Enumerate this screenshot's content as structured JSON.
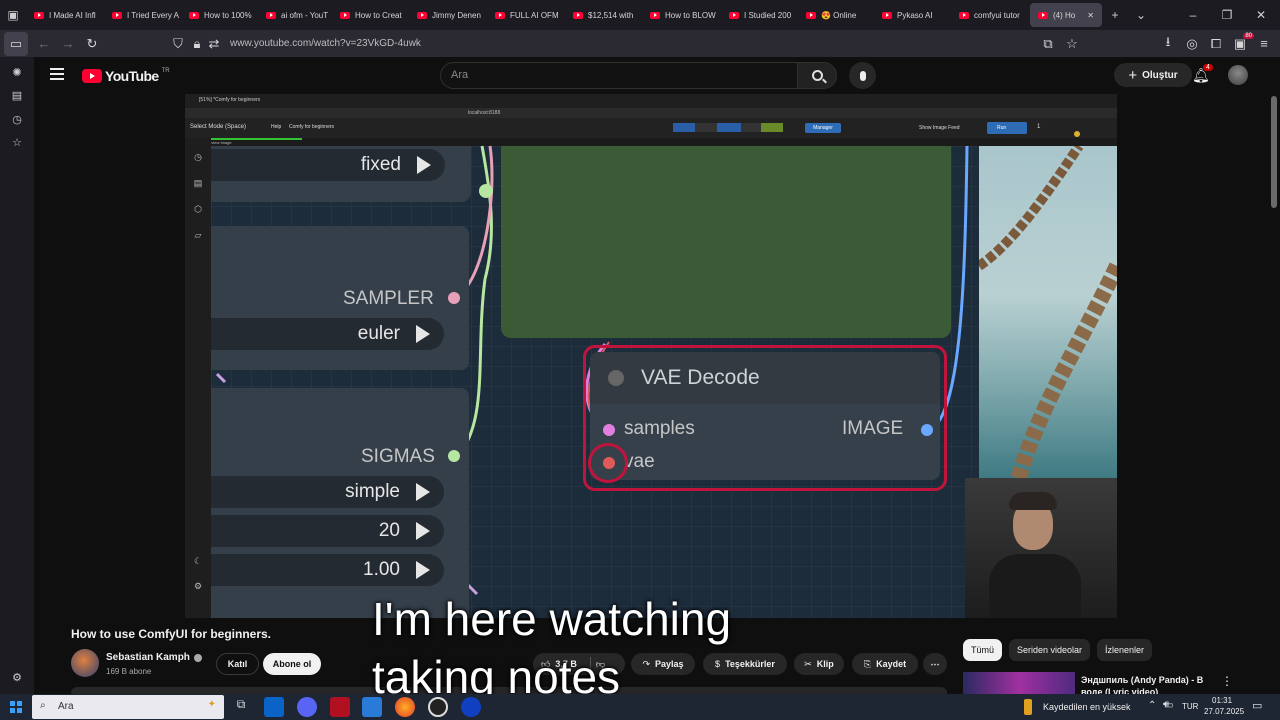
{
  "browser": {
    "tabs": [
      {
        "label": "I Made AI Infl",
        "active": false
      },
      {
        "label": "I Tried Every A",
        "active": false
      },
      {
        "label": "How to 100%",
        "active": false
      },
      {
        "label": "ai ofm - YouT",
        "active": false
      },
      {
        "label": "How to Creat",
        "active": false
      },
      {
        "label": "Jimmy Denen",
        "active": false
      },
      {
        "label": "FULL AI OFM",
        "active": false
      },
      {
        "label": "$12,514 with",
        "active": false
      },
      {
        "label": "How to BLOW",
        "active": false
      },
      {
        "label": "I Studied 200",
        "active": false
      },
      {
        "label": "😍 Online",
        "active": false
      },
      {
        "label": "Pykaso AI",
        "active": false
      },
      {
        "label": "comfyui tutor",
        "active": false
      },
      {
        "label": "(4) Ho",
        "active": true
      }
    ],
    "url": "www.youtube.com/watch?v=23VkGD-4uwk",
    "ext_badge": "80"
  },
  "youtube": {
    "logo_text": "YouTube",
    "region": "TR",
    "search_placeholder": "Ara",
    "create_label": "Oluştur",
    "notif_count": "4"
  },
  "video": {
    "inner_tab": "[51%] *Comfy for beginners",
    "inner_url": "localhost:8188",
    "inner_menu": [
      "Select Mode (Space)",
      "Help",
      "Comfy for beginners"
    ],
    "inner_manager": "Manager",
    "inner_show_image_feed": "Show Image Feed",
    "inner_run": "Run",
    "inner_run_count": "1",
    "inner_progress_label": "73.75% - Preview Image",
    "widgets": {
      "fixed": "fixed",
      "sampler_label": "SAMPLER",
      "sampler": "euler",
      "sigmas_label": "SIGMAS",
      "scheduler": "simple",
      "steps": "20",
      "denoise": "1.00"
    },
    "vae_node": {
      "title": "VAE Decode",
      "input1": "samples",
      "input2": "vae",
      "output": "IMAGE"
    },
    "caption_line1": "I'm here watching",
    "caption_line2": "taking notes"
  },
  "meta": {
    "title": "How to use ComfyUI for beginners.",
    "channel": "Sebastian Kamph",
    "subscribers": "169 B abone",
    "join_label": "Katıl",
    "subscribe_label": "Abone ol",
    "likes": "3,7 B",
    "share_label": "Paylaş",
    "thanks_label": "Teşekkürler",
    "clip_label": "Klip",
    "save_label": "Kaydet"
  },
  "recommendations": {
    "chips": [
      "Tümü",
      "Seriden videolar",
      "İzlenenler"
    ],
    "first_title": "Эндшпиль (Andy Panda) - В",
    "first_title_line2": "воде (Lyric video)"
  },
  "taskbar": {
    "search": "Ara",
    "status_text": "Kaydedilen en yüksek",
    "lang": "TUR",
    "time": "01:31",
    "date": "27.07.2025"
  },
  "colors": {
    "accent_red": "#ff0033",
    "highlight_ring": "#c0143c",
    "node_green": "#3b5a36",
    "samples_dot": "#e07fe0",
    "vae_dot": "#e05a5a",
    "image_dot": "#6aa7ff",
    "sigmas_dot": "#b7e6a0",
    "sampler_dot": "#e8a0b8"
  }
}
